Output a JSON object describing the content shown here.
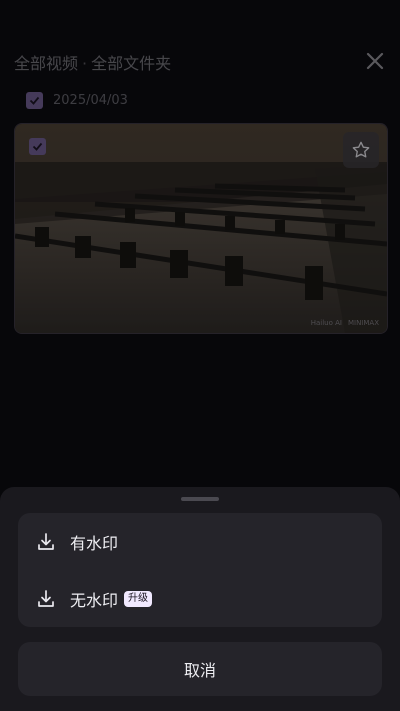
{
  "header": {
    "title_all_videos": "全部视频",
    "separator": "·",
    "title_all_folders": "全部文件夹"
  },
  "group": {
    "date": "2025/04/03",
    "selected": true
  },
  "media": {
    "selected": true,
    "watermark_left": "Hailuo AI",
    "watermark_right": "MINIMAX"
  },
  "sheet": {
    "option_with_watermark": "有水印",
    "option_without_watermark": "无水印",
    "upgrade_badge": "升级",
    "cancel_label": "取消"
  },
  "colors": {
    "accent": "#6b5a8a",
    "sheet_bg": "#1a191e",
    "card_bg": "#25242a"
  }
}
